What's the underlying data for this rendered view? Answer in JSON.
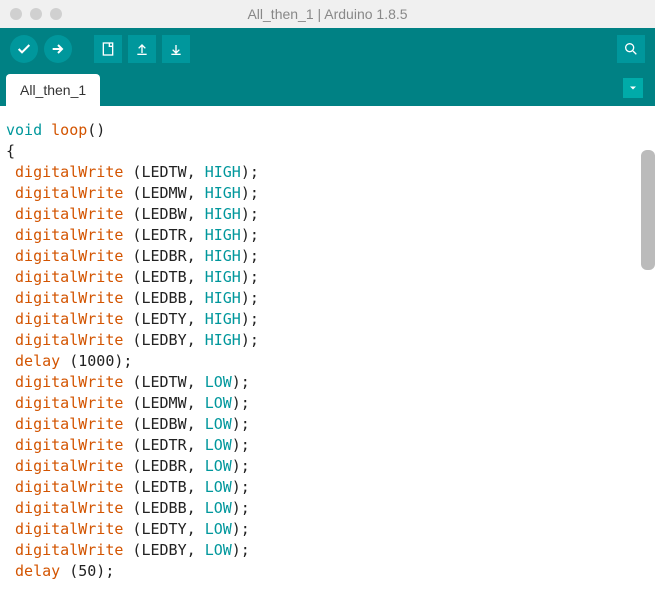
{
  "window": {
    "title": "All_then_1 | Arduino 1.8.5"
  },
  "tab": {
    "name": "All_then_1"
  },
  "code": {
    "func_decl_kw": "void",
    "func_name": "loop",
    "func_parens": "()",
    "open_brace": "{",
    "write_fn": "digitalWrite",
    "delay_fn": "delay",
    "high": "HIGH",
    "low": "LOW",
    "delay1": "1000",
    "delay2": "50",
    "leds": [
      "LEDTW",
      "LEDMW",
      "LEDBW",
      "LEDTR",
      "LEDBR",
      "LEDTB",
      "LEDBB",
      "LEDTY",
      "LEDBY"
    ]
  }
}
